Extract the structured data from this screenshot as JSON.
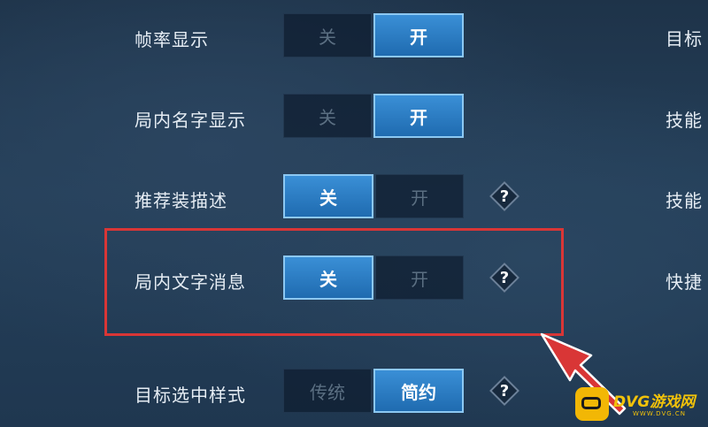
{
  "settings": [
    {
      "label": "帧率显示",
      "options": [
        "关",
        "开"
      ],
      "selected": 1,
      "help": false
    },
    {
      "label": "局内名字显示",
      "options": [
        "关",
        "开"
      ],
      "selected": 1,
      "help": false
    },
    {
      "label": "推荐装描述",
      "options": [
        "关",
        "开"
      ],
      "selected": 0,
      "help": true
    },
    {
      "label": "局内文字消息",
      "options": [
        "关",
        "开"
      ],
      "selected": 0,
      "help": true
    },
    {
      "label": "目标选中样式",
      "options": [
        "传统",
        "简约"
      ],
      "selected": 1,
      "help": true
    }
  ],
  "help_symbol": "?",
  "right_column": [
    "目标",
    "技能",
    "技能",
    "快捷"
  ],
  "annotation": {
    "highlight_color": "#d93636",
    "highlighted_setting": "局内文字消息"
  },
  "watermark": {
    "brand": "DVG游戏网",
    "url": "WWW.DVG.CN",
    "accent": "#f2c20a"
  }
}
